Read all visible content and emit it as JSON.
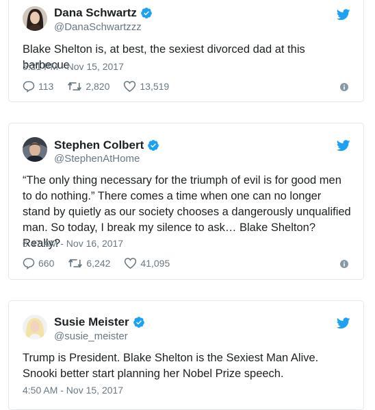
{
  "tweets": [
    {
      "name": "Dana Schwartz",
      "handle": "@DanaSchwartzzz",
      "text": "Blake Shelton is, at best, the sexiest divorced dad at this barbecue",
      "time": "5:21 PM - Nov 15, 2017",
      "replies": "113",
      "retweets": "2,820",
      "likes": "13,519"
    },
    {
      "name": "Stephen Colbert",
      "handle": "@StephenAtHome",
      "text": "“The only thing necessary for the triumph of evil is for good men to do nothing.” There comes a time when one can no longer stand by quietly as our society chooses a dangerously unqualified man. So today, I break my silence to ask… Blake Shelton? Really?",
      "time": "6:47 AM - Nov 16, 2017",
      "replies": "660",
      "retweets": "6,242",
      "likes": "41,095"
    },
    {
      "name": "Susie Meister",
      "handle": "@susie_meister",
      "text": "Trump is President. Blake Shelton is the Sexiest Man Alive. Snooki better start planning her Nobel Prize speech.",
      "time": "4:50 AM - Nov 15, 2017"
    }
  ],
  "icons": {
    "verified": "verified-badge-icon",
    "bird": "twitter-bird-icon",
    "reply": "reply-icon",
    "retweet": "retweet-icon",
    "like": "heart-icon",
    "info": "info-icon"
  },
  "colors": {
    "twitter_blue": "#1da1f2",
    "muted_text": "#697882",
    "border": "#e1e8ed"
  }
}
